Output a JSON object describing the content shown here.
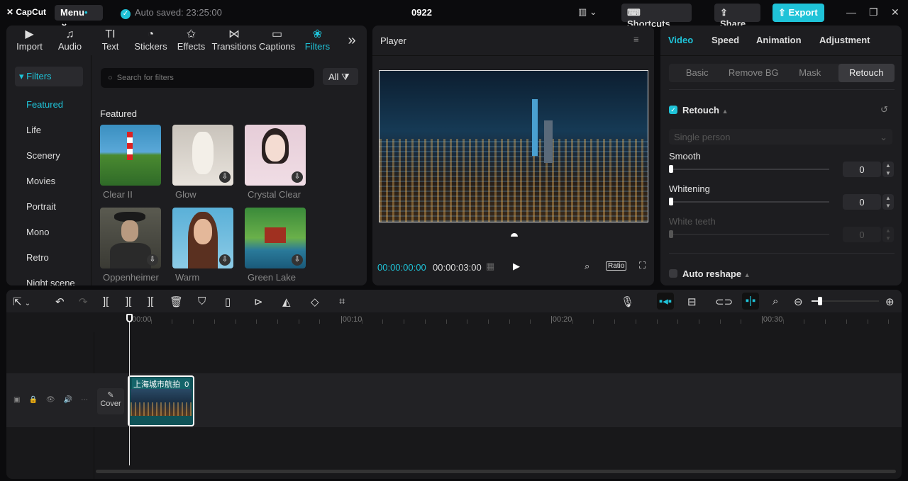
{
  "app": {
    "logo": "CapCut",
    "menu": "Menu",
    "auto_saved": "Auto saved: 23:25:00",
    "project_title": "0922",
    "shortcuts": "Shortcuts",
    "share": "Share",
    "export": "Export"
  },
  "media_tabs": [
    {
      "label": "Import",
      "icon": "▶"
    },
    {
      "label": "Audio",
      "icon": "♫"
    },
    {
      "label": "Text",
      "icon": "TI"
    },
    {
      "label": "Stickers",
      "icon": "◔"
    },
    {
      "label": "Effects",
      "icon": "✩"
    },
    {
      "label": "Transitions",
      "icon": "⋈"
    },
    {
      "label": "Captions",
      "icon": "▭"
    },
    {
      "label": "Filters",
      "icon": "❀"
    }
  ],
  "filters": {
    "header": "Filters",
    "categories": [
      "Featured",
      "Life",
      "Scenery",
      "Movies",
      "Portrait",
      "Mono",
      "Retro",
      "Night scene"
    ],
    "search_placeholder": "Search for filters",
    "all_label": "All",
    "section": "Featured",
    "items": [
      "Clear II",
      "Glow",
      "Crystal Clear",
      "Oppenheimer",
      "Warm",
      "Green Lake"
    ]
  },
  "player": {
    "title": "Player",
    "current_time": "00:00:00:00",
    "total_time": "00:00:03:00",
    "ratio": "Ratio"
  },
  "right": {
    "tabs": [
      "Video",
      "Speed",
      "Animation",
      "Adjustment"
    ],
    "subtabs": [
      "Basic",
      "Remove BG",
      "Mask",
      "Retouch"
    ],
    "retouch": "Retouch",
    "mode": "Single person",
    "smooth": "Smooth",
    "smooth_value": "0",
    "whitening": "Whitening",
    "whitening_value": "0",
    "white_teeth": "White teeth",
    "white_teeth_value": "0",
    "auto_reshape": "Auto reshape"
  },
  "timeline": {
    "ruler": [
      "00:00",
      "00:10",
      "00:20",
      "00:30"
    ],
    "cover": "Cover",
    "clip_title": "上海城市航拍",
    "clip_extra": "0"
  },
  "colors": {
    "accent": "#1fc3d8",
    "bg": "#0b0b0d",
    "panel": "#1d1d20"
  }
}
